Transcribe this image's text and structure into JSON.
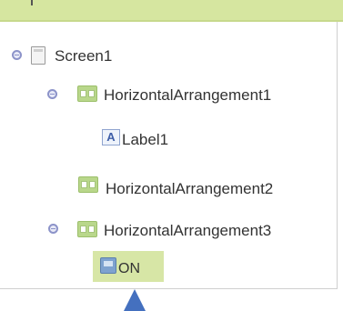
{
  "tree": {
    "root": {
      "label": "Screen1",
      "icon": "screen-icon"
    },
    "children": [
      {
        "label": "HorizontalArrangement1",
        "icon": "horizontal-arrangement-icon",
        "children": [
          {
            "label": "Label1",
            "icon": "label-icon",
            "glyph": "A"
          }
        ]
      },
      {
        "label": "HorizontalArrangement2",
        "icon": "horizontal-arrangement-icon"
      },
      {
        "label": "HorizontalArrangement3",
        "icon": "horizontal-arrangement-icon",
        "children": [
          {
            "label": "ON",
            "icon": "switch-icon",
            "selected": true
          }
        ]
      }
    ]
  },
  "colors": {
    "header": "#d6e6a0",
    "selection": "#d7e6a6",
    "toggle": "#8c93c9",
    "arrow": "#4470bf"
  }
}
